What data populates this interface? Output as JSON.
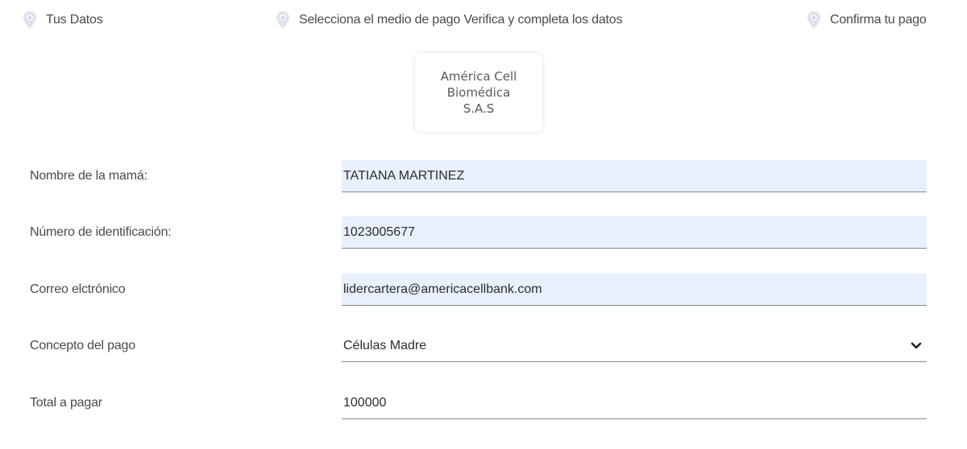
{
  "steps": [
    {
      "label": "Tus Datos",
      "icon": "location-pin-icon"
    },
    {
      "label": "Selecciona el medio de pago Verifica y completa los datos",
      "icon": "location-pin-icon"
    },
    {
      "label": "Confirma tu pago",
      "icon": "location-pin-icon"
    }
  ],
  "logo": {
    "line1": "América Cell",
    "line2": "Biomédica",
    "line3": "S.A.S"
  },
  "form": {
    "nombre": {
      "label": "Nombre de la mamá:",
      "value": "TATIANA MARTINEZ"
    },
    "identificacion": {
      "label": "Número de identificación:",
      "value": "1023005677"
    },
    "correo": {
      "label": "Correo elctrónico",
      "value": "lidercartera@americacellbank.com"
    },
    "concepto": {
      "label": "Concepto del pago",
      "selected": "Células Madre"
    },
    "total": {
      "label": "Total a pagar",
      "value": "100000"
    }
  },
  "colors": {
    "autofill_background": "#e8f0fe",
    "pin_icon": "#dfe3ea"
  }
}
